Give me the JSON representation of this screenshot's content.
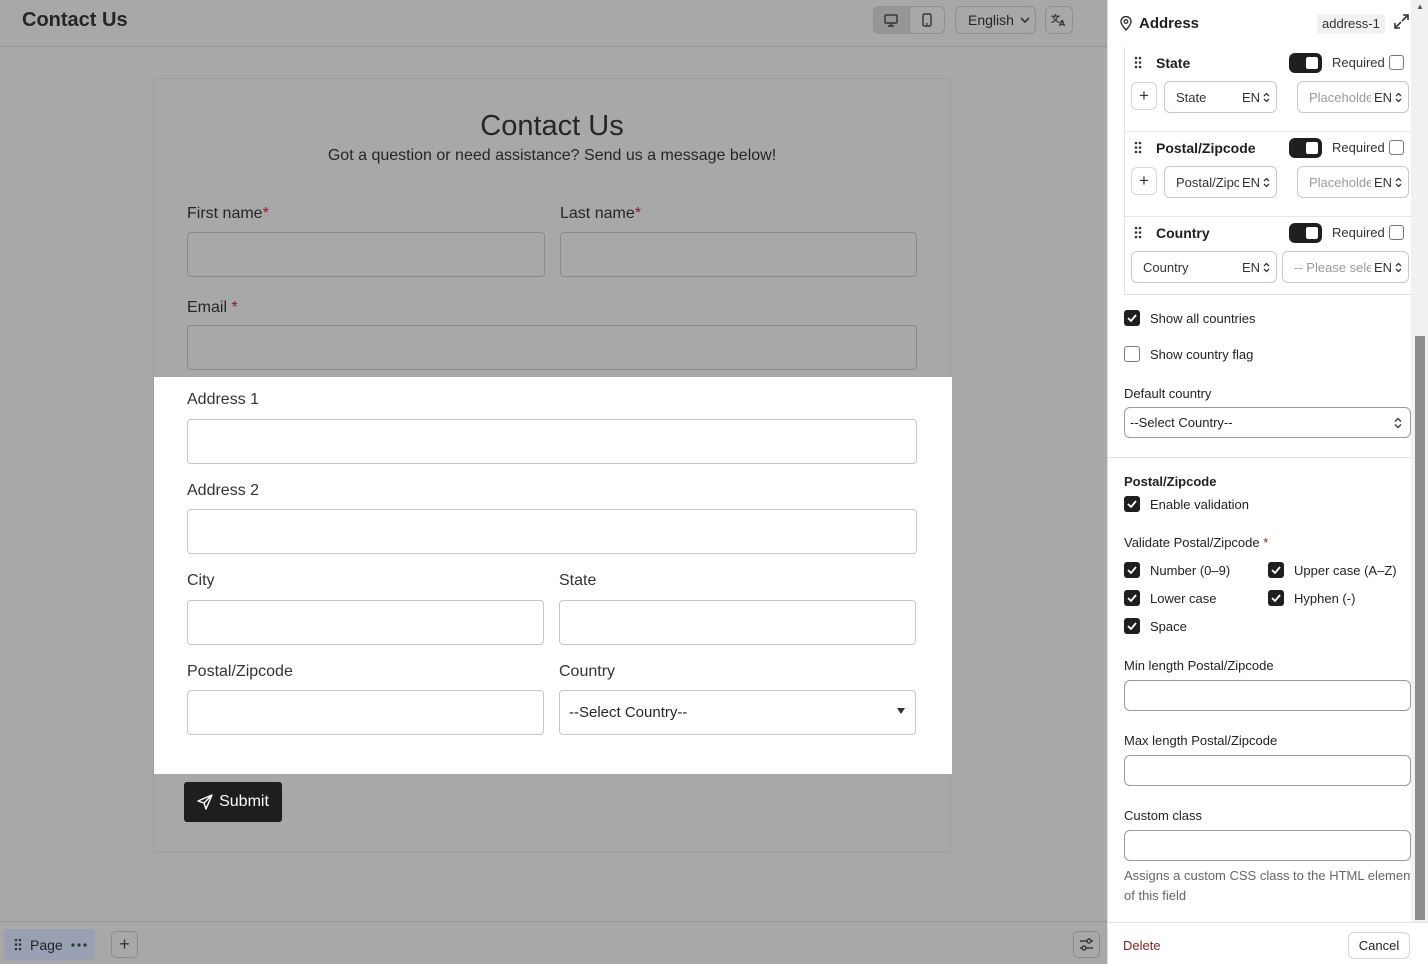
{
  "topbar": {
    "title": "Contact Us",
    "language": "English",
    "device_icons": [
      "desktop-icon",
      "mobile-icon"
    ],
    "translate_icon": "translate-icon"
  },
  "form": {
    "heading": "Contact Us",
    "subheading": "Got a question or need assistance? Send us a message below!",
    "first_name_label": "First name",
    "last_name_label": "Last name",
    "email_label": "Email",
    "required_mark": "*",
    "address1_label": "Address 1",
    "address2_label": "Address 2",
    "city_label": "City",
    "state_label": "State",
    "postal_label": "Postal/Zipcode",
    "country_label": "Country",
    "country_placeholder": "--Select Country--",
    "submit_label": "Submit"
  },
  "bottombar": {
    "page_tab_label": "Page",
    "add_label": "+"
  },
  "panel": {
    "title": "Address",
    "field_id": "address-1",
    "subfields": [
      {
        "name": "State",
        "required_label": "Required",
        "label_value": "State",
        "lang": "EN",
        "placeholder": "Placeholder",
        "placeholder_lang": "EN"
      },
      {
        "name": "Postal/Zipcode",
        "required_label": "Required",
        "label_value": "Postal/Zipcode",
        "lang": "EN",
        "placeholder": "Placeholder",
        "placeholder_lang": "EN"
      },
      {
        "name": "Country",
        "required_label": "Required",
        "label_value": "Country",
        "lang": "EN",
        "placeholder": "-- Please select --",
        "placeholder_lang": "EN"
      }
    ],
    "show_all_countries": "Show all countries",
    "show_country_flag": "Show country flag",
    "default_country_label": "Default country",
    "default_country_value": "--Select Country--",
    "postal_section": "Postal/Zipcode",
    "enable_validation": "Enable validation",
    "validate_label": "Validate Postal/Zipcode",
    "validate_required_mark": "*",
    "validate_options": [
      "Number (0–9)",
      "Upper case (A–Z)",
      "Lower case",
      "Hyphen (-)",
      "Space"
    ],
    "min_length_label": "Min length Postal/Zipcode",
    "max_length_label": "Max length Postal/Zipcode",
    "custom_class_label": "Custom class",
    "custom_class_help": "Assigns a custom CSS class to the HTML element of this field",
    "delete_label": "Delete",
    "cancel_label": "Cancel"
  },
  "colors": {
    "overlay_gray": "#a9a9a9",
    "submit_bg": "#1e1e1e",
    "required_red": "#8b1c1c",
    "toggle_on": "#1f1f1f",
    "page_tab_bg": "#97a1b3"
  }
}
